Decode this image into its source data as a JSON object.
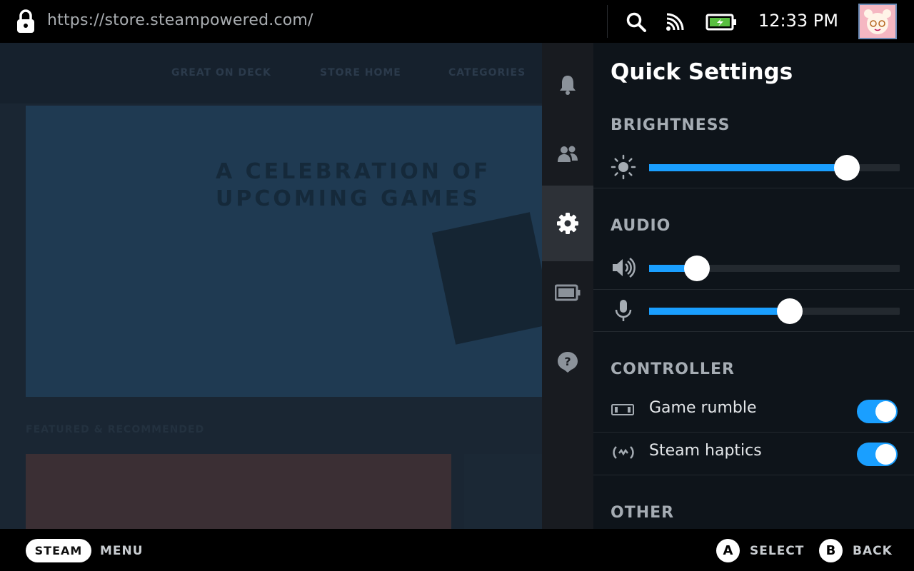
{
  "topbar": {
    "url": "https://store.steampowered.com/",
    "time": "12:33 PM",
    "icons": [
      "lock-icon",
      "search-icon",
      "cast-icon",
      "battery-charging-icon",
      "user-avatar"
    ]
  },
  "background_page": {
    "nav_items": [
      "GREAT ON DECK",
      "STORE HOME",
      "CATEGORIES"
    ],
    "hero_title_line1": "A CELEBRATION OF",
    "hero_title_line2": "UPCOMING GAMES",
    "section_title": "FEATURED & RECOMMENDED"
  },
  "rail": {
    "items": [
      {
        "name": "notifications",
        "icon": "bell-icon"
      },
      {
        "name": "friends",
        "icon": "friends-icon"
      },
      {
        "name": "quick-settings",
        "icon": "gear-icon",
        "active": true
      },
      {
        "name": "performance",
        "icon": "battery-icon"
      },
      {
        "name": "help",
        "icon": "help-icon"
      }
    ]
  },
  "panel": {
    "title": "Quick Settings",
    "brightness": {
      "header": "BRIGHTNESS",
      "value": 0.79
    },
    "audio": {
      "header": "AUDIO",
      "volume": 0.19,
      "microphone": 0.56
    },
    "controller": {
      "header": "CONTROLLER",
      "rumble_label": "Game rumble",
      "rumble_on": true,
      "haptics_label": "Steam haptics",
      "haptics_on": true
    },
    "other": {
      "header": "OTHER"
    }
  },
  "bottombar": {
    "steam_label": "STEAM",
    "menu_label": "MENU",
    "a_glyph": "A",
    "a_label": "SELECT",
    "b_glyph": "B",
    "b_label": "BACK"
  },
  "colors": {
    "accent": "#1a9fff",
    "panel_bg": "#0e141a",
    "rail_bg": "#181b20"
  }
}
